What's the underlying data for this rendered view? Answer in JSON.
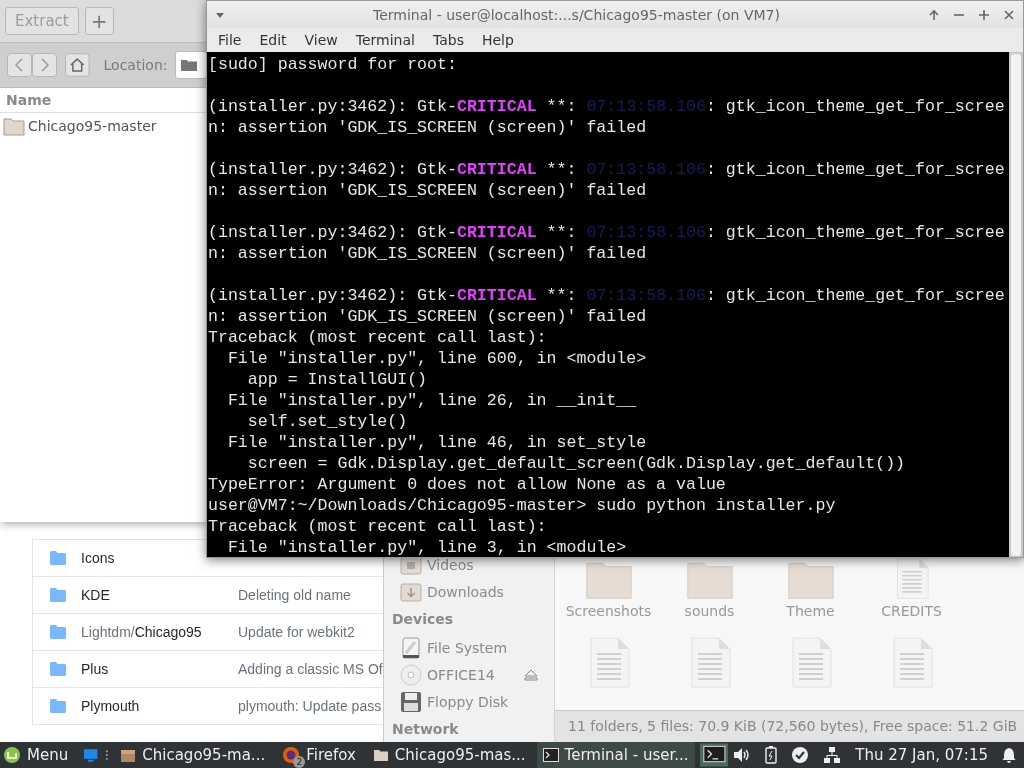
{
  "archive_window": {
    "extract_button": "Extract",
    "add_button": "+",
    "location_label": "Location:",
    "column": "Name",
    "items": [
      {
        "name": "Chicago95-master"
      }
    ]
  },
  "browser_window": {
    "rows": [
      {
        "name": "Icons"
      },
      {
        "name": "KDE",
        "message": "Deleting old name"
      },
      {
        "prefix": "Lightdm/",
        "name": "Chicago95",
        "message": "Update for webkit2"
      },
      {
        "name": "Plus",
        "message": "Adding a classic MS Of"
      },
      {
        "name": "Plymouth",
        "message": "plymouth: Update pass"
      }
    ]
  },
  "file_manager": {
    "places": [
      {
        "kind": "item",
        "label": "Videos"
      },
      {
        "kind": "item",
        "label": "Downloads"
      },
      {
        "kind": "header",
        "label": "Devices"
      },
      {
        "kind": "item",
        "label": "File System"
      },
      {
        "kind": "item",
        "label": "OFFICE14",
        "eject": true
      },
      {
        "kind": "item",
        "label": "Floppy Disk"
      },
      {
        "kind": "header",
        "label": "Network"
      }
    ],
    "icons": [
      {
        "kind": "folder",
        "label": "Screenshots"
      },
      {
        "kind": "folder",
        "label": "sounds"
      },
      {
        "kind": "folder",
        "label": "Theme"
      },
      {
        "kind": "file",
        "label": "CREDITS"
      },
      {
        "kind": "file"
      },
      {
        "kind": "file"
      },
      {
        "kind": "file"
      },
      {
        "kind": "file"
      }
    ],
    "status": "11 folders, 5 files: 70.9 KiB (72,560 bytes), Free space: 51.2 GiB"
  },
  "terminal": {
    "title": "Terminal - user@localhost:...s/Chicago95-master (on VM7)",
    "menu": [
      "File",
      "Edit",
      "View",
      "Terminal",
      "Tabs",
      "Help"
    ],
    "lines": [
      {
        "kind": "output",
        "segments": [
          {
            "kind": "text",
            "text": "[sudo] password for root:"
          }
        ]
      },
      {
        "kind": "blank"
      },
      {
        "kind": "output",
        "segments": [
          {
            "kind": "text",
            "text": "(installer.py:3462): Gtk-"
          },
          {
            "kind": "critical",
            "text": "CRITICAL"
          },
          {
            "kind": "text",
            "text": " **: "
          },
          {
            "kind": "timestamp",
            "text": "07:13:58.106"
          },
          {
            "kind": "text",
            "text": ": gtk_icon_theme_get_for_scree"
          }
        ]
      },
      {
        "kind": "output",
        "segments": [
          {
            "kind": "text",
            "text": "n: assertion 'GDK_IS_SCREEN (screen)' failed"
          }
        ]
      },
      {
        "kind": "blank"
      },
      {
        "kind": "output",
        "segments": [
          {
            "kind": "text",
            "text": "(installer.py:3462): Gtk-"
          },
          {
            "kind": "critical",
            "text": "CRITICAL"
          },
          {
            "kind": "text",
            "text": " **: "
          },
          {
            "kind": "timestamp",
            "text": "07:13:58.106"
          },
          {
            "kind": "text",
            "text": ": gtk_icon_theme_get_for_scree"
          }
        ]
      },
      {
        "kind": "output",
        "segments": [
          {
            "kind": "text",
            "text": "n: assertion 'GDK_IS_SCREEN (screen)' failed"
          }
        ]
      },
      {
        "kind": "blank"
      },
      {
        "kind": "output",
        "segments": [
          {
            "kind": "text",
            "text": "(installer.py:3462): Gtk-"
          },
          {
            "kind": "critical",
            "text": "CRITICAL"
          },
          {
            "kind": "text",
            "text": " **: "
          },
          {
            "kind": "timestamp",
            "text": "07:13:58.106"
          },
          {
            "kind": "text",
            "text": ": gtk_icon_theme_get_for_scree"
          }
        ]
      },
      {
        "kind": "output",
        "segments": [
          {
            "kind": "text",
            "text": "n: assertion 'GDK_IS_SCREEN (screen)' failed"
          }
        ]
      },
      {
        "kind": "blank"
      },
      {
        "kind": "output",
        "segments": [
          {
            "kind": "text",
            "text": "(installer.py:3462): Gtk-"
          },
          {
            "kind": "critical",
            "text": "CRITICAL"
          },
          {
            "kind": "text",
            "text": " **: "
          },
          {
            "kind": "timestamp",
            "text": "07:13:58.106"
          },
          {
            "kind": "text",
            "text": ": gtk_icon_theme_get_for_scree"
          }
        ]
      },
      {
        "kind": "output",
        "segments": [
          {
            "kind": "text",
            "text": "n: assertion 'GDK_IS_SCREEN (screen)' failed"
          }
        ]
      },
      {
        "kind": "output",
        "segments": [
          {
            "kind": "text",
            "text": "Traceback (most recent call last):"
          }
        ]
      },
      {
        "kind": "output",
        "segments": [
          {
            "kind": "text",
            "text": "  File \"installer.py\", line 600, in <module>"
          }
        ]
      },
      {
        "kind": "output",
        "segments": [
          {
            "kind": "text",
            "text": "    app = InstallGUI()"
          }
        ]
      },
      {
        "kind": "output",
        "segments": [
          {
            "kind": "text",
            "text": "  File \"installer.py\", line 26, in __init__"
          }
        ]
      },
      {
        "kind": "output",
        "segments": [
          {
            "kind": "text",
            "text": "    self.set_style()"
          }
        ]
      },
      {
        "kind": "output",
        "segments": [
          {
            "kind": "text",
            "text": "  File \"installer.py\", line 46, in set_style"
          }
        ]
      },
      {
        "kind": "output",
        "segments": [
          {
            "kind": "text",
            "text": "    screen = Gdk.Display.get_default_screen(Gdk.Display.get_default())"
          }
        ]
      },
      {
        "kind": "output",
        "segments": [
          {
            "kind": "text",
            "text": "TypeError: Argument 0 does not allow None as a value"
          }
        ]
      },
      {
        "kind": "output",
        "segments": [
          {
            "kind": "text",
            "text": "user@VM7:~/Downloads/Chicago95-master> sudo python installer.py"
          }
        ]
      },
      {
        "kind": "output",
        "segments": [
          {
            "kind": "text",
            "text": "Traceback (most recent call last):"
          }
        ]
      },
      {
        "kind": "output",
        "segments": [
          {
            "kind": "text",
            "text": "  File \"installer.py\", line 3, in <module>"
          }
        ]
      }
    ]
  },
  "taskbar": {
    "menu": "Menu",
    "tasks": [
      {
        "kind": "files",
        "label": "Chicago95-ma...",
        "selected": false
      },
      {
        "kind": "firefox",
        "label": "Firefox",
        "badge": "2",
        "selected": false
      },
      {
        "kind": "folder",
        "label": "Chicago95-mas...",
        "selected": false
      },
      {
        "kind": "terminal",
        "label": "Terminal - user...",
        "selected": true
      }
    ],
    "clock": "Thu 27 Jan, 07:15"
  }
}
